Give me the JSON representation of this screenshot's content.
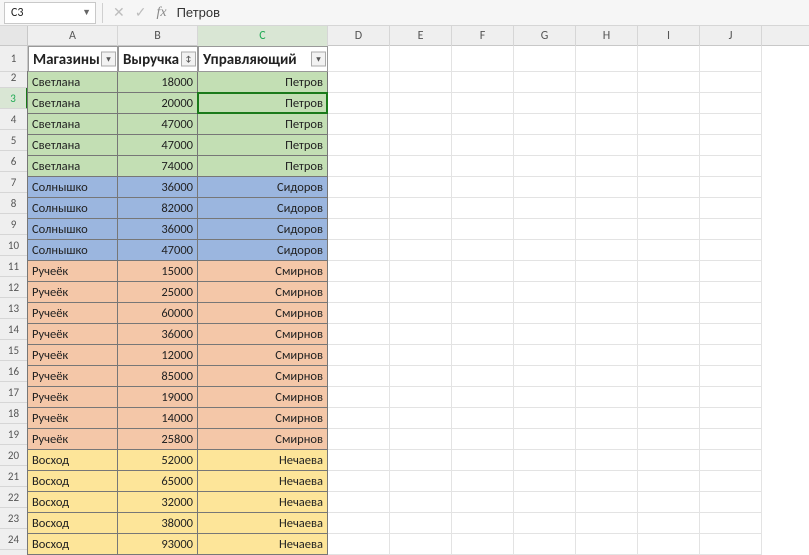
{
  "formula_bar": {
    "name_box": "C3",
    "formula_value": "Петров"
  },
  "col_letters": [
    "A",
    "B",
    "C",
    "D",
    "E",
    "F",
    "G",
    "H",
    "I",
    "J"
  ],
  "active_col_index": 2,
  "active_row_index": 2,
  "headers": {
    "a": "Магазины",
    "b": "Выручка",
    "c": "Управляющий"
  },
  "filter_glyphs": {
    "a": "▾",
    "b": "↕",
    "c": "▾"
  },
  "rows": [
    {
      "n": 2,
      "store": "Светлана",
      "rev": 18000,
      "mgr": "Петров",
      "cls": "green"
    },
    {
      "n": 3,
      "store": "Светлана",
      "rev": 20000,
      "mgr": "Петров",
      "cls": "green",
      "sel": true
    },
    {
      "n": 4,
      "store": "Светлана",
      "rev": 47000,
      "mgr": "Петров",
      "cls": "green"
    },
    {
      "n": 5,
      "store": "Светлана",
      "rev": 47000,
      "mgr": "Петров",
      "cls": "green"
    },
    {
      "n": 6,
      "store": "Светлана",
      "rev": 74000,
      "mgr": "Петров",
      "cls": "green"
    },
    {
      "n": 7,
      "store": "Солнышко",
      "rev": 36000,
      "mgr": "Сидоров",
      "cls": "blue"
    },
    {
      "n": 8,
      "store": "Солнышко",
      "rev": 82000,
      "mgr": "Сидоров",
      "cls": "blue"
    },
    {
      "n": 9,
      "store": "Солнышко",
      "rev": 36000,
      "mgr": "Сидоров",
      "cls": "blue"
    },
    {
      "n": 10,
      "store": "Солнышко",
      "rev": 47000,
      "mgr": "Сидоров",
      "cls": "blue"
    },
    {
      "n": 11,
      "store": "Ручеёк",
      "rev": 15000,
      "mgr": "Смирнов",
      "cls": "peach"
    },
    {
      "n": 12,
      "store": "Ручеёк",
      "rev": 25000,
      "mgr": "Смирнов",
      "cls": "peach"
    },
    {
      "n": 13,
      "store": "Ручеёк",
      "rev": 60000,
      "mgr": "Смирнов",
      "cls": "peach"
    },
    {
      "n": 14,
      "store": "Ручеёк",
      "rev": 36000,
      "mgr": "Смирнов",
      "cls": "peach"
    },
    {
      "n": 15,
      "store": "Ручеёк",
      "rev": 12000,
      "mgr": "Смирнов",
      "cls": "peach"
    },
    {
      "n": 16,
      "store": "Ручеёк",
      "rev": 85000,
      "mgr": "Смирнов",
      "cls": "peach"
    },
    {
      "n": 17,
      "store": "Ручеёк",
      "rev": 19000,
      "mgr": "Смирнов",
      "cls": "peach"
    },
    {
      "n": 18,
      "store": "Ручеёк",
      "rev": 14000,
      "mgr": "Смирнов",
      "cls": "peach"
    },
    {
      "n": 19,
      "store": "Ручеёк",
      "rev": 25800,
      "mgr": "Смирнов",
      "cls": "peach"
    },
    {
      "n": 20,
      "store": "Восход",
      "rev": 52000,
      "mgr": "Нечаева",
      "cls": "yellow"
    },
    {
      "n": 21,
      "store": "Восход",
      "rev": 65000,
      "mgr": "Нечаева",
      "cls": "yellow"
    },
    {
      "n": 22,
      "store": "Восход",
      "rev": 32000,
      "mgr": "Нечаева",
      "cls": "yellow"
    },
    {
      "n": 23,
      "store": "Восход",
      "rev": 38000,
      "mgr": "Нечаева",
      "cls": "yellow"
    },
    {
      "n": 24,
      "store": "Восход",
      "rev": 93000,
      "mgr": "Нечаева",
      "cls": "yellow"
    }
  ]
}
